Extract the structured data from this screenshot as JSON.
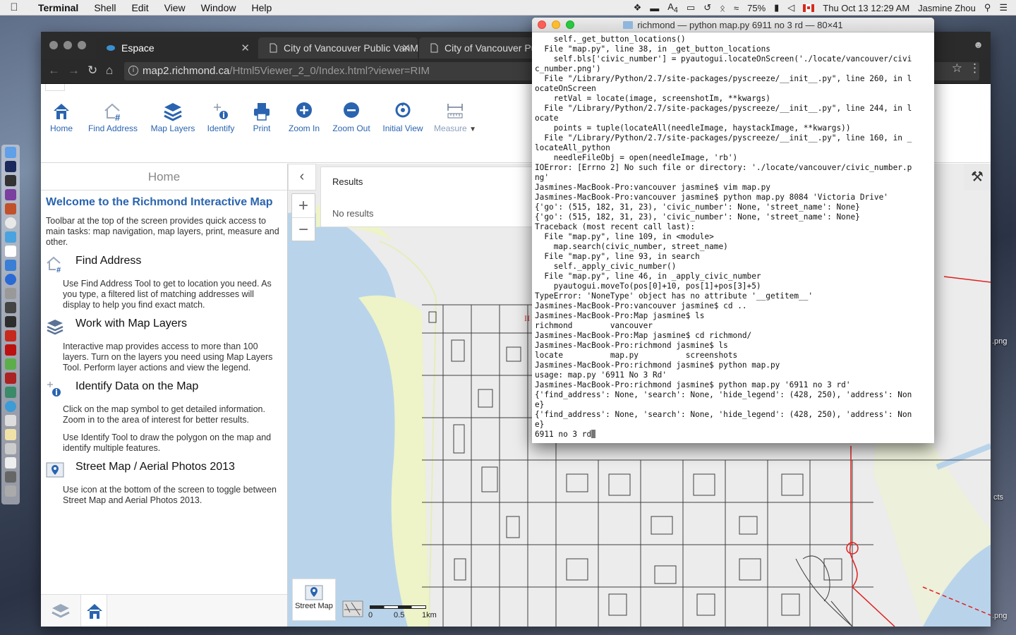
{
  "menubar": {
    "app": "Terminal",
    "items": [
      "Shell",
      "Edit",
      "View",
      "Window",
      "Help"
    ],
    "battery": "75%",
    "adobe_count": "4",
    "datetime": "Thu Oct 13  12:29 AM",
    "user": "Jasmine Zhou"
  },
  "desktop": {
    "labels": [
      ".png",
      "cts",
      ".png"
    ]
  },
  "browser": {
    "tabs": [
      {
        "title": "Espace",
        "active": true
      },
      {
        "title": "City of Vancouver Public VanM",
        "active": false
      },
      {
        "title": "City of Vancouver Publ",
        "active": false
      }
    ],
    "url_host": "map2.richmond.ca",
    "url_path": "/Html5Viewer_2_0/Index.html?viewer=RIM"
  },
  "toolbar": {
    "tools": [
      {
        "label": "Home",
        "icon": "home-icon"
      },
      {
        "label": "Find Address",
        "icon": "find-address-icon"
      },
      {
        "label": "Map Layers",
        "icon": "layers-icon"
      },
      {
        "label": "Identify",
        "icon": "identify-icon"
      },
      {
        "label": "Print",
        "icon": "print-icon"
      },
      {
        "label": "Zoom In",
        "icon": "zoom-in-icon"
      },
      {
        "label": "Zoom Out",
        "icon": "zoom-out-icon"
      },
      {
        "label": "Initial View",
        "icon": "initial-view-icon"
      }
    ],
    "measure": "Measure"
  },
  "sidepanel": {
    "header": "Home",
    "title": "Welcome to the Richmond Interactive Map",
    "intro": "Toolbar at the top of the screen provides quick access to main tasks: map navigation, map layers, print, measure and other.",
    "sections": [
      {
        "heading": "Find Address",
        "body": [
          "Use Find Address Tool to get to location you need. As you type, a filtered list of matching addresses will display to help you find exact match."
        ]
      },
      {
        "heading": "Work with Map Layers",
        "body": [
          "Interactive map provides access to more than 100 layers. Turn on the layers you need using Map Layers Tool. Perform layer actions and view the legend."
        ]
      },
      {
        "heading": "Identify Data on the Map",
        "body": [
          "Click on the map symbol to get detailed information. Zoom in to the area of interest for better results.",
          "Use Identify Tool to draw the polygon on the map and identify multiple features."
        ]
      },
      {
        "heading": "Street Map / Aerial Photos 2013",
        "body": [
          "Use icon at the bottom of the screen to toggle between Street Map and Aerial Photos 2013."
        ]
      }
    ]
  },
  "map": {
    "results_title": "Results",
    "results_empty": "No results",
    "zoom_in": "+",
    "zoom_out": "−",
    "basemap_label": "Street Map",
    "scale_labels": [
      "0",
      "0.5",
      "1km"
    ]
  },
  "terminal": {
    "title": "richmond — python map.py 6911 no 3 rd — 80×41",
    "lines": [
      "    self._get_button_locations()",
      "  File \"map.py\", line 38, in _get_button_locations",
      "    self.bls['civic_number'] = pyautogui.locateOnScreen('./locate/vancouver/civi",
      "c_number.png')",
      "  File \"/Library/Python/2.7/site-packages/pyscreeze/__init__.py\", line 260, in l",
      "ocateOnScreen",
      "    retVal = locate(image, screenshotIm, **kwargs)",
      "  File \"/Library/Python/2.7/site-packages/pyscreeze/__init__.py\", line 244, in l",
      "ocate",
      "    points = tuple(locateAll(needleImage, haystackImage, **kwargs))",
      "  File \"/Library/Python/2.7/site-packages/pyscreeze/__init__.py\", line 160, in _",
      "locateAll_python",
      "    needleFileObj = open(needleImage, 'rb')",
      "IOError: [Errno 2] No such file or directory: './locate/vancouver/civic_number.p",
      "ng'",
      "Jasmines-MacBook-Pro:vancouver jasmine$ vim map.py",
      "Jasmines-MacBook-Pro:vancouver jasmine$ python map.py 8084 'Victoria Drive'",
      "{'go': (515, 182, 31, 23), 'civic_number': None, 'street_name': None}",
      "{'go': (515, 182, 31, 23), 'civic_number': None, 'street_name': None}",
      "Traceback (most recent call last):",
      "  File \"map.py\", line 109, in <module>",
      "    map.search(civic_number, street_name)",
      "  File \"map.py\", line 93, in search",
      "    self._apply_civic_number()",
      "  File \"map.py\", line 46, in _apply_civic_number",
      "    pyautogui.moveTo(pos[0]+10, pos[1]+pos[3]+5)",
      "TypeError: 'NoneType' object has no attribute '__getitem__'",
      "Jasmines-MacBook-Pro:vancouver jasmine$ cd ..",
      "Jasmines-MacBook-Pro:Map jasmine$ ls",
      "richmond        vancouver",
      "Jasmines-MacBook-Pro:Map jasmine$ cd richmond/",
      "Jasmines-MacBook-Pro:richmond jasmine$ ls",
      "locate          map.py          screenshots",
      "Jasmines-MacBook-Pro:richmond jasmine$ python map.py",
      "usage: map.py '6911 No 3 Rd'",
      "Jasmines-MacBook-Pro:richmond jasmine$ python map.py '6911 no 3 rd'",
      "{'find_address': None, 'search': None, 'hide_legend': (428, 250), 'address': Non",
      "e}",
      "{'find_address': None, 'search': None, 'hide_legend': (428, 250), 'address': Non",
      "e}",
      "6911 no 3 rd"
    ]
  }
}
